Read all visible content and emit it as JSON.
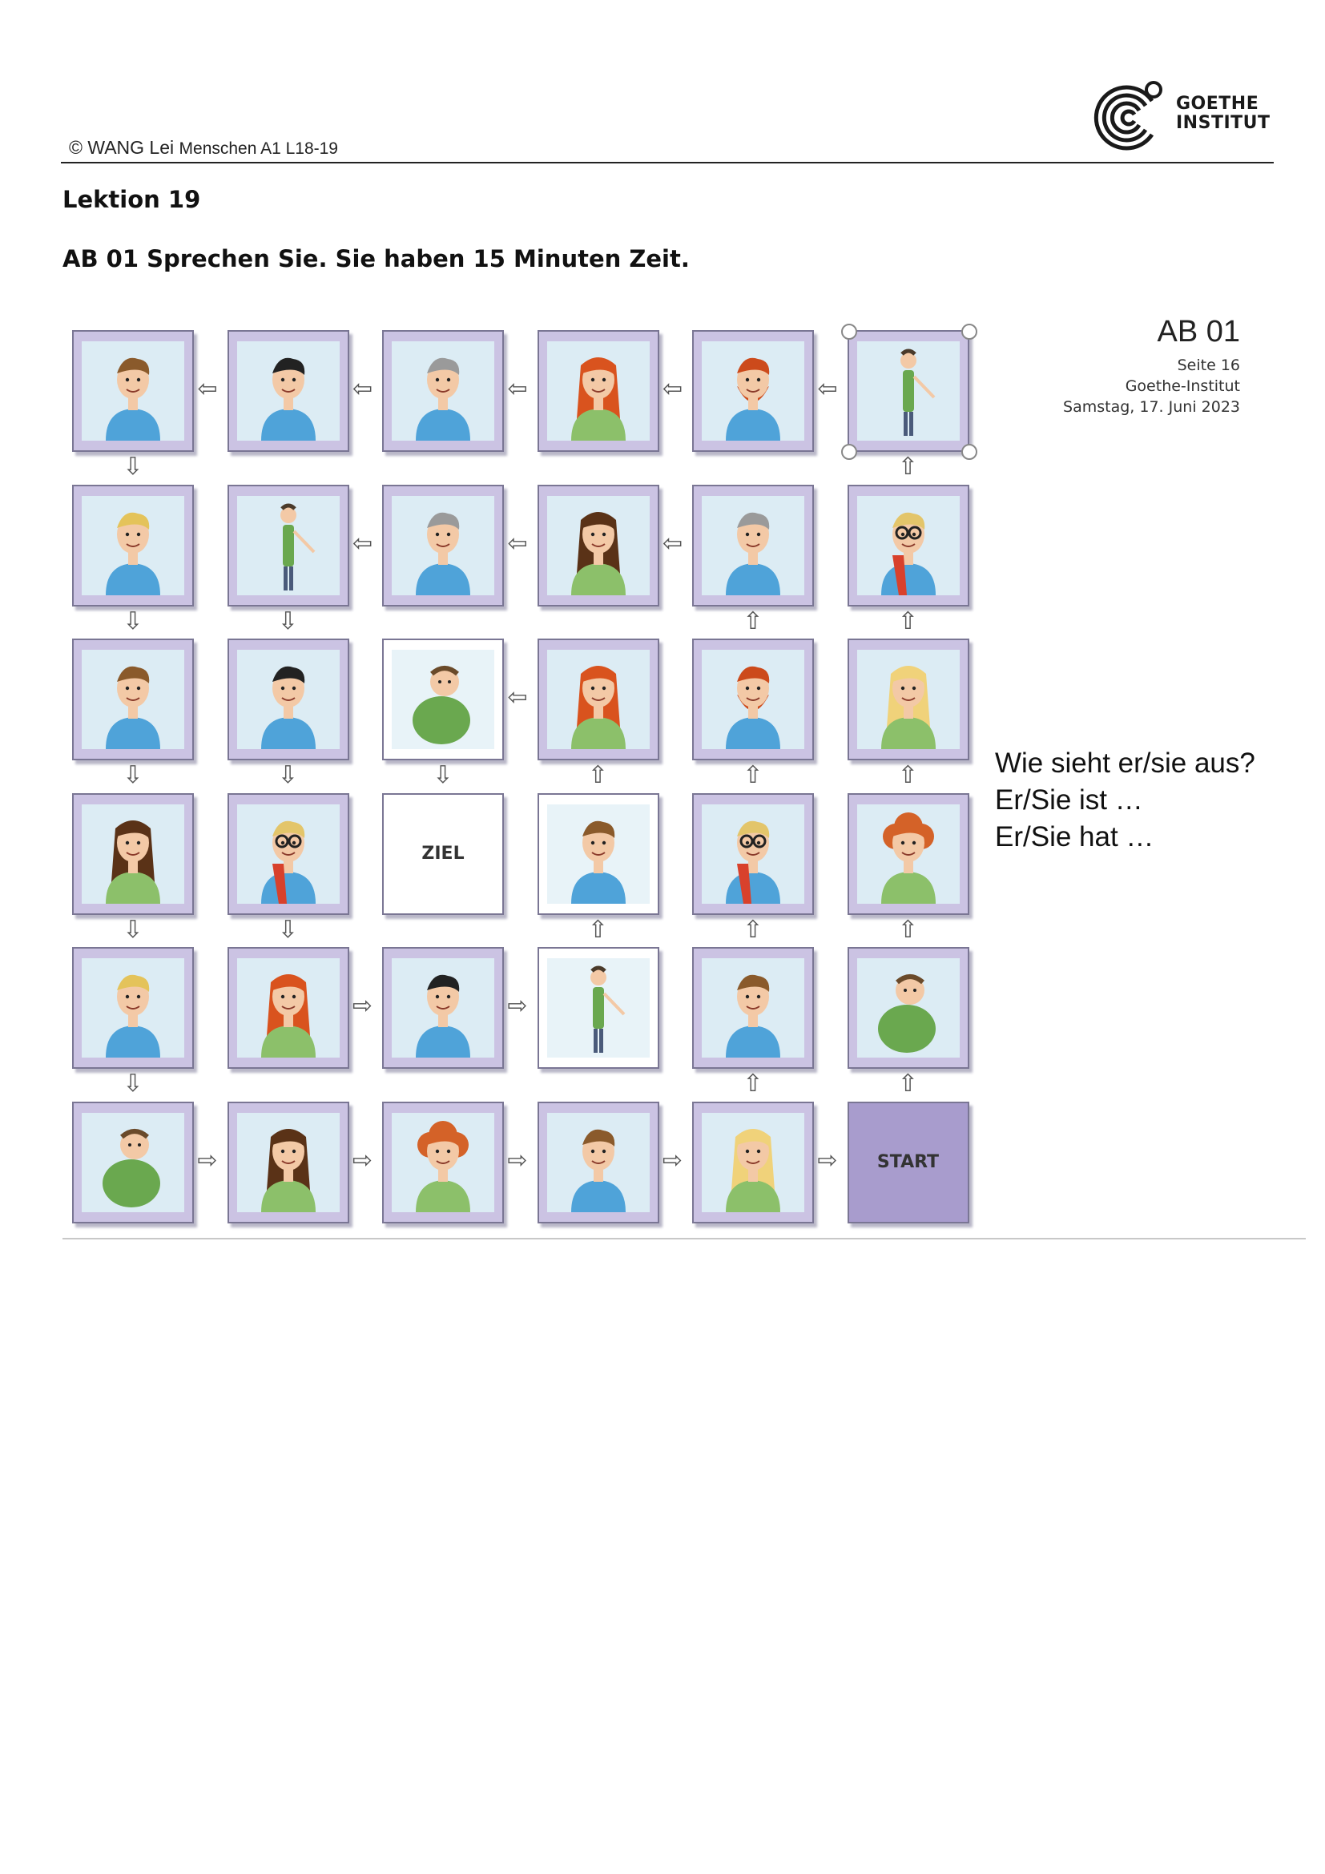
{
  "header": {
    "copyright": "© WANG Lei",
    "course": "Menschen A1 L18-19",
    "logo_line1": "GOETHE",
    "logo_line2": "INSTITUT"
  },
  "lesson_title": "Lektion 19",
  "task_title": "AB 01 Sprechen Sie. Sie haben 15  Minuten Zeit.",
  "board": {
    "ab_title": "AB 01",
    "page": "Seite 16",
    "publisher": "Goethe-Institut",
    "date": "Samstag, 17. Juni 2023",
    "goal_label": "ZIEL",
    "start_label": "START",
    "prompts": [
      "Wie sieht er/sie aus?",
      "Er/Sie ist …",
      "Er/Sie hat …"
    ],
    "colors": {
      "square_purple": "#cbc3e3",
      "start_purple": "#a89ccd",
      "border": "#7a7694"
    },
    "cells": [
      [
        "man-short-hair",
        "man-black-hair",
        "man-grey-hair",
        "woman-long-red-hair",
        "man-red-beard",
        "tall-thin-man"
      ],
      [
        "man-blond-hair",
        "tall-thin-man",
        "man-grey-hair",
        "woman-long-brown-hair",
        "man-grey-hair",
        "man-glasses-red-scarf"
      ],
      [
        "man-short-hair",
        "man-black-hair",
        "fat-man",
        "woman-long-red-hair",
        "man-red-beard",
        "woman-blond-hair"
      ],
      [
        "woman-long-brown-hair",
        "man-glasses-red-scarf",
        "goal",
        "man-short-hair",
        "man-glasses-red-scarf",
        "woman-curly-red-hair"
      ],
      [
        "man-blond-hair",
        "woman-long-red-hair",
        "man-black-hair",
        "tall-thin-man",
        "man-short-hair",
        "fat-man"
      ],
      [
        "fat-man",
        "woman-long-brown-hair",
        "woman-curly-red-hair",
        "man-short-hair",
        "woman-blond-hair",
        "start"
      ]
    ]
  }
}
